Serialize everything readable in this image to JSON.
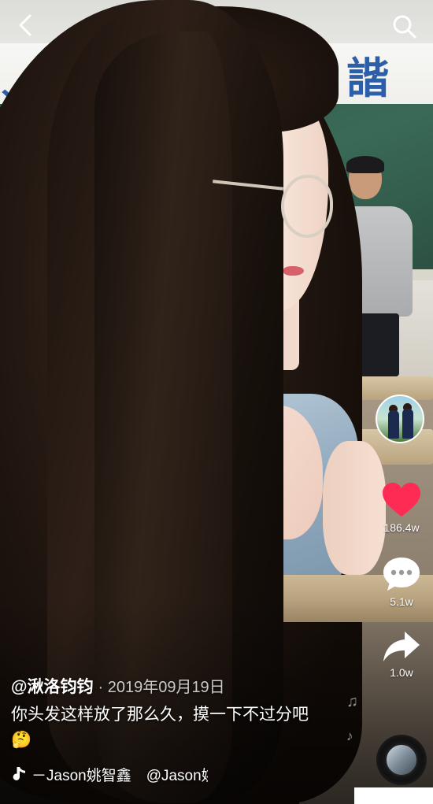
{
  "header": {
    "back_icon": "chevron-left-icon",
    "search_icon": "search-icon"
  },
  "sidebar": {
    "avatar_icon": "user-avatar",
    "like": {
      "icon": "heart-icon",
      "count": "186.4w",
      "color": "#fe2c55"
    },
    "comment": {
      "icon": "comment-bubble-icon",
      "count": "5.1w"
    },
    "share": {
      "icon": "share-arrow-icon",
      "count": "1.0w"
    }
  },
  "post": {
    "author": "@湫洛钧钧",
    "date": "· 2019年09月19日",
    "caption": "你头发这样放了那么久，摸一下不过分吧🤔",
    "music": "－Jason姚智鑫　@Jason姚智鑫创作的原声"
  },
  "player": {
    "music_disc_icon": "music-disc-icon"
  }
}
